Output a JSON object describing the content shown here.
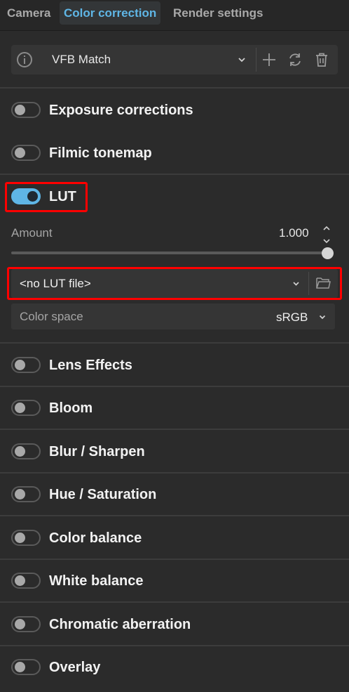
{
  "tabs": [
    {
      "label": "Camera"
    },
    {
      "label": "Color correction"
    },
    {
      "label": "Render settings"
    }
  ],
  "active_tab": "Color correction",
  "preset": {
    "selected": "VFB Match",
    "icons": [
      "info-icon",
      "chevron-down-icon",
      "plus-icon",
      "refresh-icon",
      "trash-icon"
    ]
  },
  "sections": [
    {
      "label": "Exposure corrections",
      "enabled": false
    },
    {
      "label": "Filmic tonemap",
      "enabled": false
    },
    {
      "label": "LUT",
      "enabled": true
    },
    {
      "label": "Lens Effects",
      "enabled": false
    },
    {
      "label": "Bloom",
      "enabled": false
    },
    {
      "label": "Blur / Sharpen",
      "enabled": false
    },
    {
      "label": "Hue / Saturation",
      "enabled": false
    },
    {
      "label": "Color balance",
      "enabled": false
    },
    {
      "label": "White balance",
      "enabled": false
    },
    {
      "label": "Chromatic aberration",
      "enabled": false
    },
    {
      "label": "Overlay",
      "enabled": false
    }
  ],
  "lut": {
    "amount_label": "Amount",
    "amount_value": "1.000",
    "amount_fraction": 1.0,
    "file": "<no LUT file>",
    "color_space_label": "Color space",
    "color_space_value": "sRGB"
  },
  "colors": {
    "accent": "#5fb6e6",
    "highlight": "#ff0000",
    "background": "#2b2b2b"
  }
}
